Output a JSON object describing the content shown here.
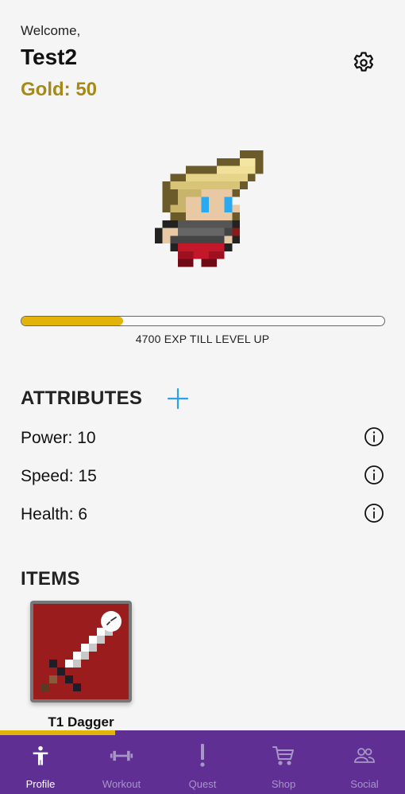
{
  "header": {
    "welcome": "Welcome,",
    "username": "Test2",
    "gold": "Gold: 50"
  },
  "icons": {
    "settings": "gear-icon",
    "add_attribute": "plus-icon",
    "info": "info-icon"
  },
  "experience": {
    "progress": 0.28,
    "text": "4700 EXP TILL LEVEL UP"
  },
  "attributes": {
    "title": "ATTRIBUTES",
    "items": [
      {
        "label": "Power: 10"
      },
      {
        "label": "Speed: 15"
      },
      {
        "label": "Health: 6"
      }
    ]
  },
  "items": {
    "title": "ITEMS",
    "list": [
      {
        "name": "T1 Dagger",
        "icon": "dagger-icon"
      }
    ]
  },
  "nav": {
    "active": "Profile",
    "items": [
      {
        "label": "Profile",
        "icon": "person-icon"
      },
      {
        "label": "Workout",
        "icon": "dumbbell-icon"
      },
      {
        "label": "Quest",
        "icon": "exclamation-icon"
      },
      {
        "label": "Shop",
        "icon": "cart-icon"
      },
      {
        "label": "Social",
        "icon": "people-icon"
      }
    ]
  },
  "colors": {
    "background": "#f5f5f5",
    "gold_text": "#a78a16",
    "exp_fill": "#e2b40a",
    "accent_blue": "#29a3e8",
    "nav_background": "#5f2f94",
    "nav_label_inactive": "#a896c6",
    "item_background": "#9a1c1c"
  }
}
